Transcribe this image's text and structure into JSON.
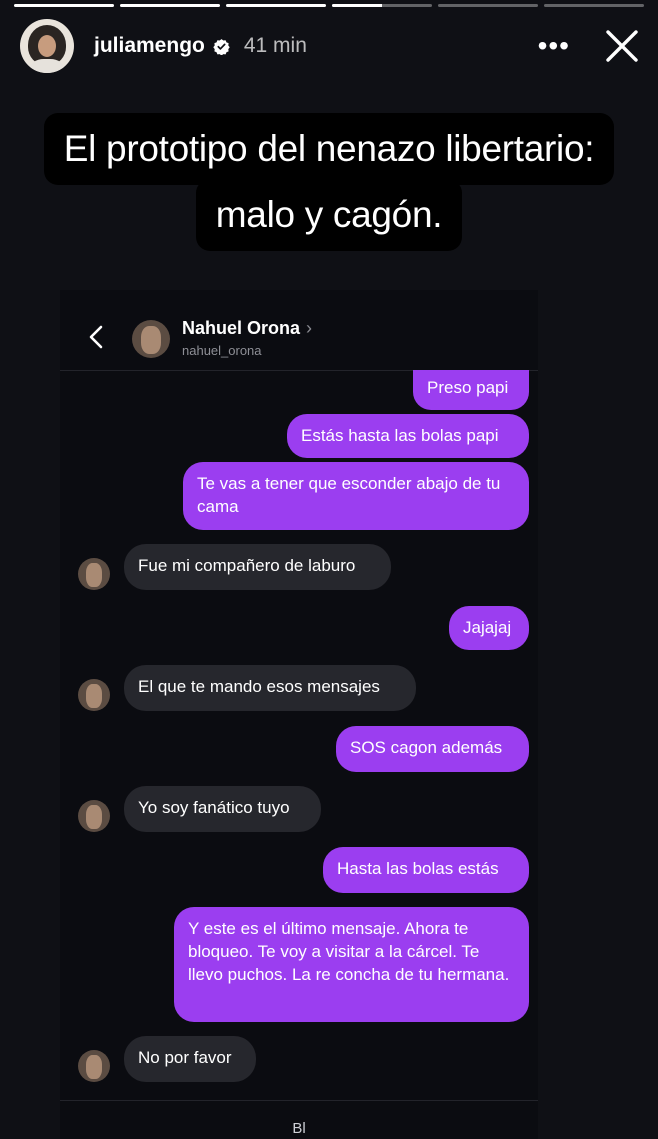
{
  "story": {
    "username": "juliamengo",
    "time": "41 min",
    "more_label": "•••",
    "progress": [
      1,
      1,
      1,
      0.5,
      0,
      0
    ],
    "caption_lines": [
      "El prototipo del nenazo libertario:",
      "malo y cagón."
    ]
  },
  "dm": {
    "contact_name": "Nahuel Orona",
    "contact_handle": "nahuel_orona",
    "chevron": "›",
    "footer_text": "Bl                                                                                                                                                                                                                    ",
    "messages": [
      {
        "from": "me",
        "text": "Preso papi"
      },
      {
        "from": "me",
        "text": "Estás hasta las bolas papi"
      },
      {
        "from": "me",
        "text": "Te vas a tener que esconder abajo de tu cama"
      },
      {
        "from": "them",
        "text": "Fue mi compañero de laburo"
      },
      {
        "from": "me",
        "text": "Jajajaj"
      },
      {
        "from": "them",
        "text": "El que te mando esos mensajes"
      },
      {
        "from": "me",
        "text": "SOS cagon además"
      },
      {
        "from": "them",
        "text": "Yo soy fanático tuyo"
      },
      {
        "from": "me",
        "text": "Hasta las bolas estás"
      },
      {
        "from": "me",
        "text": "Y este es el último mensaje. Ahora te bloqueo. Te voy a visitar a la cárcel. Te llevo puchos. La re concha de tu hermana."
      },
      {
        "from": "them",
        "text": "No por favor"
      }
    ]
  },
  "colors": {
    "background": "#0f1015",
    "outgoing_bubble": "#9b3ef0",
    "incoming_bubble": "#26272d",
    "verified_badge": "#ffffff"
  },
  "icons": {
    "verified": "verified-badge-icon",
    "more": "more-options-icon",
    "close": "close-icon",
    "back": "back-chevron-icon"
  }
}
